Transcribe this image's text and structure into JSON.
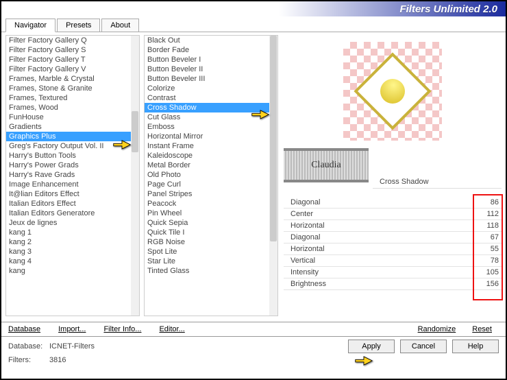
{
  "title": "Filters Unlimited 2.0",
  "tabs": [
    "Navigator",
    "Presets",
    "About"
  ],
  "list1": [
    "Filter Factory Gallery Q",
    "Filter Factory Gallery S",
    "Filter Factory Gallery T",
    "Filter Factory Gallery V",
    "Frames, Marble & Crystal",
    "Frames, Stone & Granite",
    "Frames, Textured",
    "Frames, Wood",
    "FunHouse",
    "Gradients",
    "Graphics Plus",
    "Greg's Factory Output Vol. II",
    "Harry's Button Tools",
    "Harry's Power Grads",
    "Harry's Rave Grads",
    "Image Enhancement",
    "It@lian Editors Effect",
    "Italian Editors Effect",
    "Italian Editors Generatore",
    "Jeux de lignes",
    "kang 1",
    "kang 2",
    "kang 3",
    "kang 4",
    "kang"
  ],
  "list1_selected_index": 10,
  "list2": [
    "Black Out",
    "Border Fade",
    "Button Beveler I",
    "Button Beveler II",
    "Button Beveler III",
    "Colorize",
    "Contrast",
    "Cross Shadow",
    "Cut Glass",
    "Emboss",
    "Horizontal Mirror",
    "Instant Frame",
    "Kaleidoscope",
    "Metal Border",
    "Old Photo",
    "Page Curl",
    "Panel Stripes",
    "Peacock",
    "Pin Wheel",
    "Quick Sepia",
    "Quick Tile I",
    "RGB Noise",
    "Spot Lite",
    "Star Lite",
    "Tinted Glass"
  ],
  "list2_selected_index": 7,
  "filter_name": "Cross Shadow",
  "watermark": "Claudia",
  "params": [
    {
      "label": "Diagonal",
      "value": 86
    },
    {
      "label": "Center",
      "value": 112
    },
    {
      "label": "Horizontal",
      "value": 118
    },
    {
      "label": "Diagonal",
      "value": 67
    },
    {
      "label": "Horizontal",
      "value": 55
    },
    {
      "label": "Vertical",
      "value": 78
    },
    {
      "label": "Intensity",
      "value": 105
    },
    {
      "label": "Brightness",
      "value": 156
    }
  ],
  "bottom_links": {
    "database": "Database",
    "import": "Import...",
    "filter_info": "Filter Info...",
    "editor": "Editor...",
    "randomize": "Randomize",
    "reset": "Reset"
  },
  "status": {
    "db_label": "Database:",
    "db_value": "ICNET-Filters",
    "filters_label": "Filters:",
    "filters_value": "3816"
  },
  "buttons": {
    "apply": "Apply",
    "cancel": "Cancel",
    "help": "Help"
  }
}
